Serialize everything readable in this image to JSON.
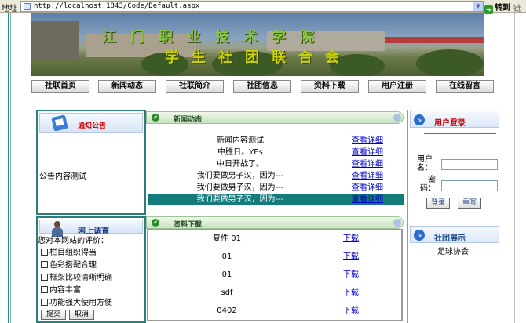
{
  "browser": {
    "address_label": "地址",
    "url": "http://localhost:1843/Code/Default.aspx",
    "go_label": "转到",
    "links_label": "链"
  },
  "banner": {
    "line1": "江门职业技术学院",
    "line2": "学生社团联合会"
  },
  "nav": [
    "社联首页",
    "新闻动态",
    "社联简介",
    "社团信息",
    "资料下载",
    "用户注册",
    "在线留言"
  ],
  "notice": {
    "title": "通知公告",
    "content": "公告内容测试"
  },
  "survey": {
    "title": "网上调查",
    "question": "您对本网站的评价：",
    "options": [
      "栏目组织得当",
      "色彩搭配合理",
      "框架比较清晰明确",
      "内容丰富",
      "功能强大使用方便"
    ],
    "submit_label": "提交",
    "cancel_label": "取消"
  },
  "news": {
    "title": "新闻动态",
    "link_label": "查看详细",
    "items": [
      "新闻内容测试",
      "中胜日。YEs",
      "中日开战了。",
      "我们要做男子汉，因为---",
      "我们要做男子汉，因为---",
      "我们要做男子汉，因为---"
    ],
    "selected_index": 5
  },
  "downloads": {
    "title": "资料下载",
    "link_label": "下载",
    "items": [
      "复件 01",
      "01",
      "01",
      "sdf",
      "0402"
    ]
  },
  "login": {
    "title": "用户登录",
    "username_label": "用户名：",
    "password_label": "密码：",
    "login_button": "登录",
    "reset_button": "重写"
  },
  "clubs": {
    "title": "社团展示",
    "items": [
      "足球协会"
    ]
  },
  "colors": {
    "frame_teal": "#2e7d7d",
    "selected_row": "#157a7a",
    "link_blue": "#0000cc",
    "accent_red": "#cc0000"
  }
}
